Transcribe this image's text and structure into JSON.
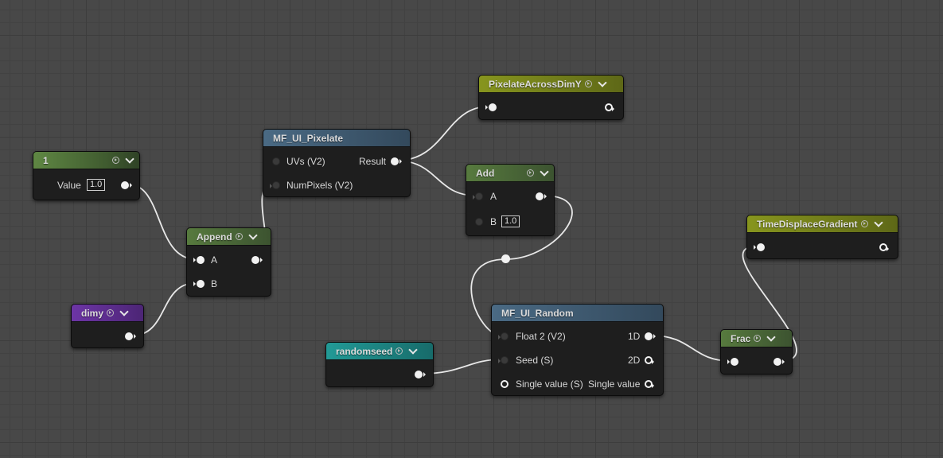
{
  "colors": {
    "wire": "#e8e8e8",
    "pin": "#f2f2f2",
    "node_body": "#1e1e1e"
  },
  "nodes": {
    "constant1": {
      "title": "1",
      "value_label": "Value",
      "value": "1.0"
    },
    "dimy": {
      "title": "dimy"
    },
    "append": {
      "title": "Append",
      "pin_a": "A",
      "pin_b": "B"
    },
    "pixelate": {
      "title": "MF_UI_Pixelate",
      "in_uvs": "UVs (V2)",
      "in_numpixels": "NumPixels (V2)",
      "out_result": "Result"
    },
    "pixelate_across": {
      "title": "PixelateAcrossDimY"
    },
    "add": {
      "title": "Add",
      "pin_a": "A",
      "pin_b": "B",
      "b_value": "1.0"
    },
    "random": {
      "title": "MF_UI_Random",
      "in_float2": "Float 2 (V2)",
      "in_seed": "Seed (S)",
      "in_single": "Single value (S)",
      "out_1d": "1D",
      "out_2d": "2D",
      "out_single": "Single value"
    },
    "randomseed": {
      "title": "randomseed"
    },
    "frac": {
      "title": "Frac"
    },
    "time_displace": {
      "title": "TimeDisplaceGradient"
    }
  }
}
